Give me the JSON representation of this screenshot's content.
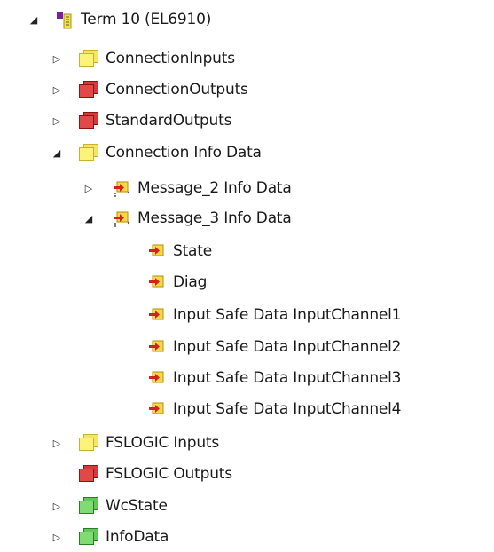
{
  "tree": {
    "items": [
      {
        "label": "Term 10 (EL6910)",
        "state": "expanded",
        "icon": "terminal-icon"
      },
      {
        "label": "ConnectionInputs",
        "state": "collapsed",
        "icon": "yellow-stack-icon"
      },
      {
        "label": "ConnectionOutputs",
        "state": "collapsed",
        "icon": "red-stack-icon"
      },
      {
        "label": "StandardOutputs",
        "state": "collapsed",
        "icon": "red-stack-icon"
      },
      {
        "label": "Connection Info Data",
        "state": "expanded",
        "icon": "yellow-stack-icon"
      },
      {
        "label": "Message_2 Info Data",
        "state": "collapsed",
        "icon": "linked-variable-icon"
      },
      {
        "label": "Message_3 Info Data",
        "state": "expanded",
        "icon": "linked-variable-icon"
      },
      {
        "label": "State",
        "state": "leaf",
        "icon": "variable-icon"
      },
      {
        "label": "Diag",
        "state": "leaf",
        "icon": "variable-icon"
      },
      {
        "label": "Input Safe Data InputChannel1",
        "state": "leaf",
        "icon": "variable-icon"
      },
      {
        "label": "Input Safe Data InputChannel2",
        "state": "leaf",
        "icon": "variable-icon"
      },
      {
        "label": "Input Safe Data InputChannel3",
        "state": "leaf",
        "icon": "variable-icon"
      },
      {
        "label": "Input Safe Data InputChannel4",
        "state": "leaf",
        "icon": "variable-icon"
      },
      {
        "label": "FSLOGIC Inputs",
        "state": "collapsed",
        "icon": "yellow-stack-icon"
      },
      {
        "label": "FSLOGIC Outputs",
        "state": "leaf",
        "icon": "red-stack-icon"
      },
      {
        "label": "WcState",
        "state": "collapsed",
        "icon": "green-stack-icon"
      },
      {
        "label": "InfoData",
        "state": "collapsed",
        "icon": "green-stack-icon"
      }
    ]
  },
  "colors": {
    "yellow": "#fff27a",
    "red": "#e24848",
    "green": "#7fdc73",
    "purple": "#7a1fa2",
    "var_arrow_red": "#d62020",
    "var_box_yellow": "#ffd84a"
  }
}
